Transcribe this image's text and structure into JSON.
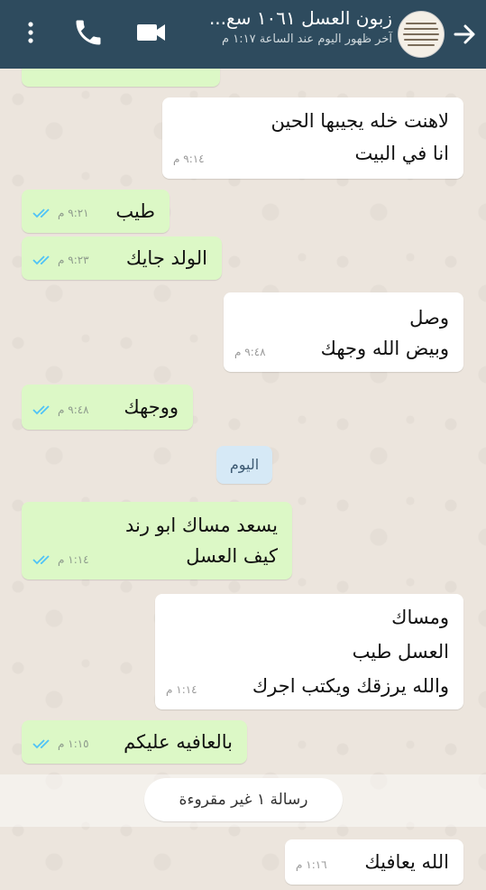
{
  "header": {
    "contact_name": "زبون العسل ١٠٦١ سع...",
    "last_seen": "آخر ظهور اليوم عند الساعة ١:١٧ م",
    "colors": {
      "header_bg": "#2e4b5e",
      "out_bubble": "#dcf8c6",
      "in_bubble": "#ffffff",
      "read_ticks": "#4fc3f7"
    },
    "icons": {
      "back": "arrow-right-icon",
      "video": "video-camera-icon",
      "call": "phone-icon",
      "menu": "more-vertical-icon"
    }
  },
  "messages": [
    {
      "dir": "in",
      "lines": [
        "لاهنت خله يجيبها الحين",
        "انا في البيت"
      ],
      "time": "٩:١٤ م"
    },
    {
      "dir": "out",
      "lines": [
        "طيب"
      ],
      "time": "٩:٢١ م",
      "status": "read"
    },
    {
      "dir": "out",
      "lines": [
        "الولد جايك"
      ],
      "time": "٩:٢٣ م",
      "status": "read"
    },
    {
      "dir": "in",
      "lines": [
        "وصل",
        "وبيض الله وجهك"
      ],
      "time": "٩:٤٨ م"
    },
    {
      "dir": "out",
      "lines": [
        "ووجهك"
      ],
      "time": "٩:٤٨ م",
      "status": "read"
    },
    {
      "dir": "out",
      "lines": [
        "يسعد مساك ابو رند",
        "كيف العسل"
      ],
      "time": "١:١٤ م",
      "status": "read"
    },
    {
      "dir": "in",
      "lines": [
        "ومساك",
        "العسل طيب",
        "والله يرزقك ويكتب اجرك"
      ],
      "time": "١:١٤ م"
    },
    {
      "dir": "out",
      "lines": [
        "بالعافيه عليكم"
      ],
      "time": "١:١٥ م",
      "status": "read"
    },
    {
      "dir": "in",
      "lines": [
        "الله يعافيك"
      ],
      "time": "١:١٦ م"
    }
  ],
  "date_divider": "اليوم",
  "unread_divider": "رسالة ١ غير مقروءة"
}
